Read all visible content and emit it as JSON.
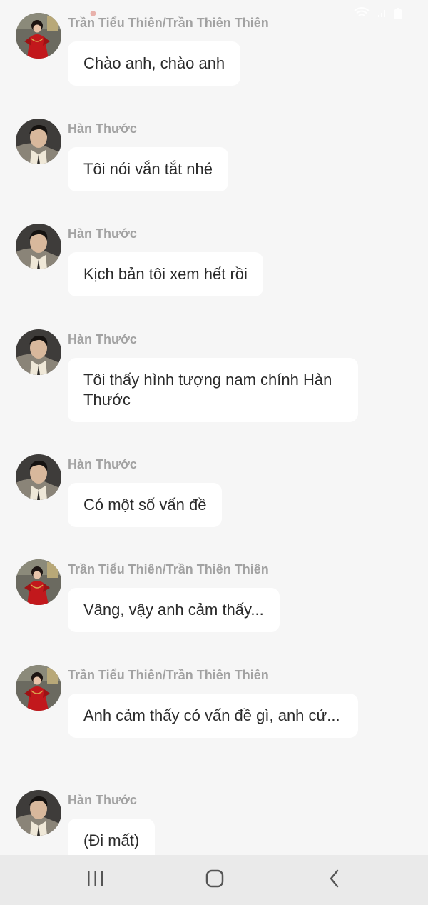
{
  "status_bar": {
    "left_icon": "notification-icon",
    "right_icons": [
      "wifi-icon",
      "signal-icon",
      "battery-icon"
    ]
  },
  "messages": [
    {
      "sender": "Trần Tiểu Thiên/Trần Thiên Thiên",
      "avatar": "avatar-red-dress",
      "text": "Chào anh, chào anh"
    },
    {
      "sender": "Hàn Thước",
      "avatar": "avatar-young-man",
      "text": "Tôi nói vắn tắt nhé"
    },
    {
      "sender": "Hàn Thước",
      "avatar": "avatar-young-man",
      "text": "Kịch bản tôi xem hết rồi"
    },
    {
      "sender": "Hàn Thước",
      "avatar": "avatar-young-man",
      "text": "Tôi thấy hình tượng nam chính Hàn Thước"
    },
    {
      "sender": "Hàn Thước",
      "avatar": "avatar-young-man",
      "text": "Có một số vấn đề"
    },
    {
      "sender": "Trần Tiểu Thiên/Trần Thiên Thiên",
      "avatar": "avatar-red-dress",
      "text": "Vâng, vậy anh cảm thấy..."
    },
    {
      "sender": "Trần Tiểu Thiên/Trần Thiên Thiên",
      "avatar": "avatar-red-dress",
      "text": "Anh cảm thấy có vấn đề gì, anh cứ..."
    },
    {
      "sender": "Hàn Thước",
      "avatar": "avatar-young-man",
      "text": "(Đi mất)"
    }
  ],
  "navbar": {
    "recent_icon": "recent-apps-icon",
    "home_icon": "home-icon",
    "back_icon": "back-icon"
  },
  "colors": {
    "background": "#f6f6f6",
    "bubble": "#ffffff",
    "sender_text": "#a2a2a2",
    "message_text": "#2a2a2a",
    "navbar": "#eaeaea"
  }
}
